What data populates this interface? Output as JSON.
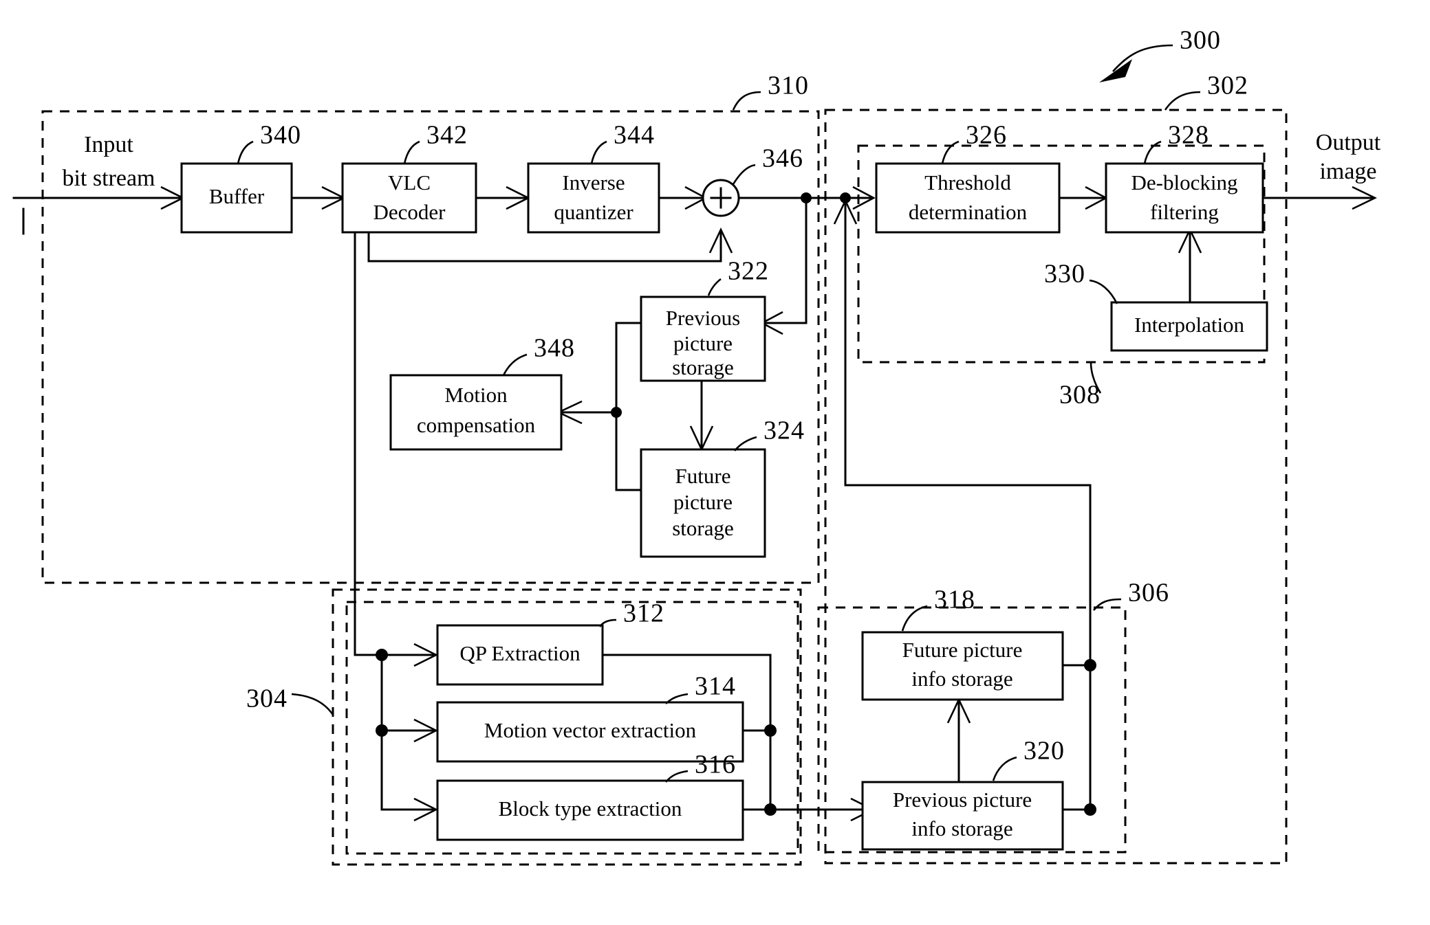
{
  "figure": {
    "title_ref": "300",
    "io_labels": {
      "input_line1": "Input",
      "input_line2": "bit stream",
      "input_mark": "I",
      "output_line1": "Output",
      "output_line2": "image"
    },
    "blocks": [
      {
        "id": "buffer",
        "ref": "340",
        "lines": [
          "Buffer"
        ]
      },
      {
        "id": "vlc_decoder",
        "ref": "342",
        "lines": [
          "VLC",
          "Decoder"
        ]
      },
      {
        "id": "inverse_quant",
        "ref": "344",
        "lines": [
          "Inverse",
          "quantizer"
        ]
      },
      {
        "id": "adder",
        "ref": "346",
        "lines": [
          "+"
        ]
      },
      {
        "id": "prev_pic_store",
        "ref": "322",
        "lines": [
          "Previous",
          "picture",
          "storage"
        ]
      },
      {
        "id": "future_pic_store",
        "ref": "324",
        "lines": [
          "Future",
          "picture",
          "storage"
        ]
      },
      {
        "id": "motion_comp",
        "ref": "348",
        "lines": [
          "Motion",
          "compensation"
        ]
      },
      {
        "id": "threshold_det",
        "ref": "326",
        "lines": [
          "Threshold",
          "determination"
        ]
      },
      {
        "id": "deblock_filter",
        "ref": "328",
        "lines": [
          "De-blocking",
          "filtering"
        ]
      },
      {
        "id": "interpolation",
        "ref": "330",
        "lines": [
          "Interpolation"
        ]
      },
      {
        "id": "qp_extraction",
        "ref": "312",
        "lines": [
          "QP Extraction"
        ]
      },
      {
        "id": "mv_extraction",
        "ref": "314",
        "lines": [
          "Motion vector extraction"
        ]
      },
      {
        "id": "blocktype_extraction",
        "ref": "316",
        "lines": [
          "Block type extraction"
        ]
      },
      {
        "id": "future_info_store",
        "ref": "318",
        "lines": [
          "Future picture",
          "info storage"
        ]
      },
      {
        "id": "prev_info_store",
        "ref": "320",
        "lines": [
          "Previous picture",
          "info storage"
        ]
      }
    ],
    "groups": [
      {
        "id": "decoder_group",
        "ref": "310"
      },
      {
        "id": "postproc_group",
        "ref": "302"
      },
      {
        "id": "filter_group",
        "ref": "308"
      },
      {
        "id": "extraction_group",
        "ref": "304"
      },
      {
        "id": "info_group",
        "ref": "306"
      }
    ],
    "reference_numerals": [
      "300",
      "302",
      "304",
      "306",
      "308",
      "310",
      "312",
      "314",
      "316",
      "318",
      "320",
      "322",
      "324",
      "326",
      "328",
      "330",
      "340",
      "342",
      "344",
      "346",
      "348"
    ],
    "colors": {
      "stroke": "#000000",
      "fill": "#ffffff"
    }
  }
}
